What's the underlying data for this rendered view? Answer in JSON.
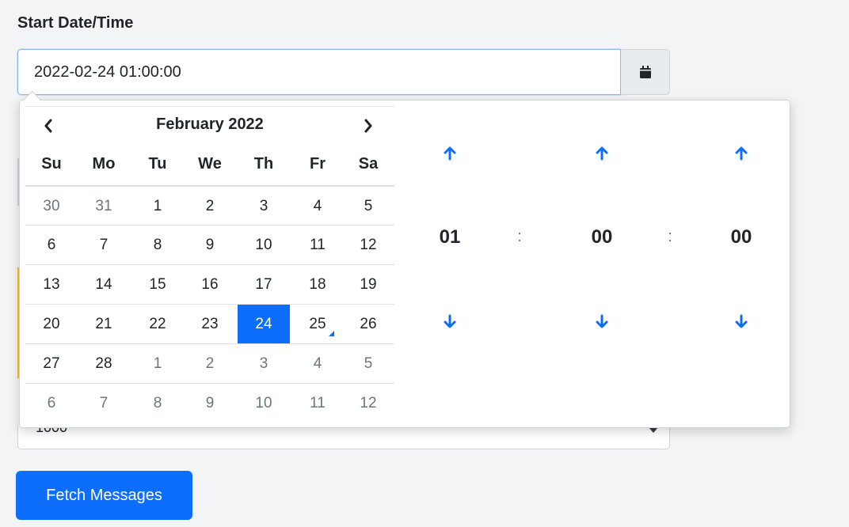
{
  "field": {
    "label": "Start Date/Time",
    "value": "2022-02-24 01:00:00",
    "calendar_icon": "calendar-icon"
  },
  "background": {
    "select_value": "1000",
    "fetch_button": "Fetch Messages",
    "colors": {
      "accent": "#0d6efd",
      "warning_strip": "#ffc107"
    }
  },
  "picker": {
    "prev_icon": "chevron-left-icon",
    "next_icon": "chevron-right-icon",
    "month_title": "February 2022",
    "weekdays": [
      "Su",
      "Mo",
      "Tu",
      "We",
      "Th",
      "Fr",
      "Sa"
    ],
    "weeks": [
      [
        {
          "d": "30",
          "t": "old"
        },
        {
          "d": "31",
          "t": "old"
        },
        {
          "d": "1"
        },
        {
          "d": "2"
        },
        {
          "d": "3"
        },
        {
          "d": "4"
        },
        {
          "d": "5"
        }
      ],
      [
        {
          "d": "6"
        },
        {
          "d": "7"
        },
        {
          "d": "8"
        },
        {
          "d": "9"
        },
        {
          "d": "10"
        },
        {
          "d": "11"
        },
        {
          "d": "12"
        }
      ],
      [
        {
          "d": "13"
        },
        {
          "d": "14"
        },
        {
          "d": "15"
        },
        {
          "d": "16"
        },
        {
          "d": "17"
        },
        {
          "d": "18"
        },
        {
          "d": "19"
        }
      ],
      [
        {
          "d": "20"
        },
        {
          "d": "21"
        },
        {
          "d": "22"
        },
        {
          "d": "23"
        },
        {
          "d": "24",
          "t": "active"
        },
        {
          "d": "25",
          "t": "today"
        },
        {
          "d": "26"
        }
      ],
      [
        {
          "d": "27"
        },
        {
          "d": "28"
        },
        {
          "d": "1",
          "t": "new"
        },
        {
          "d": "2",
          "t": "new"
        },
        {
          "d": "3",
          "t": "new"
        },
        {
          "d": "4",
          "t": "new"
        },
        {
          "d": "5",
          "t": "new"
        }
      ],
      [
        {
          "d": "6",
          "t": "new"
        },
        {
          "d": "7",
          "t": "new"
        },
        {
          "d": "8",
          "t": "new"
        },
        {
          "d": "9",
          "t": "new"
        },
        {
          "d": "10",
          "t": "new"
        },
        {
          "d": "11",
          "t": "new"
        },
        {
          "d": "12",
          "t": "new"
        }
      ]
    ],
    "time": {
      "hours": "01",
      "minutes": "00",
      "seconds": "00",
      "separator": ":",
      "up_icon": "arrow-up-icon",
      "down_icon": "arrow-down-icon"
    }
  }
}
